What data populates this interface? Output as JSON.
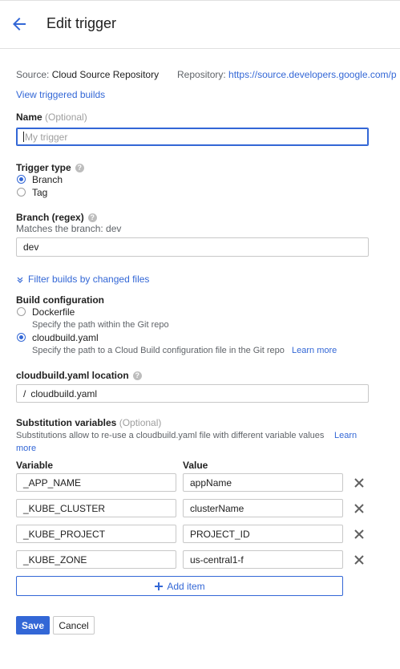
{
  "header": {
    "title": "Edit trigger"
  },
  "source": {
    "label": "Source:",
    "value": "Cloud Source Repository",
    "repo_label": "Repository:",
    "repo_value": "https://source.developers.google.com/p",
    "view_builds": "View triggered builds"
  },
  "name_field": {
    "label": "Name",
    "optional": "(Optional)",
    "placeholder": "My trigger",
    "value": ""
  },
  "trigger_type": {
    "label": "Trigger type",
    "options": [
      {
        "label": "Branch",
        "selected": true
      },
      {
        "label": "Tag",
        "selected": false
      }
    ]
  },
  "branch": {
    "label": "Branch (regex)",
    "hint": "Matches the branch: dev",
    "value": "dev"
  },
  "filter": {
    "label": "Filter builds by changed files"
  },
  "build_config": {
    "label": "Build configuration",
    "options": [
      {
        "label": "Dockerfile",
        "desc": "Specify the path within the Git repo",
        "selected": false
      },
      {
        "label": "cloudbuild.yaml",
        "desc": "Specify the path to a Cloud Build configuration file in the Git repo",
        "selected": true
      }
    ],
    "learn_more": "Learn more"
  },
  "location": {
    "label": "cloudbuild.yaml location",
    "prefix": "/",
    "value": "cloudbuild.yaml"
  },
  "substitutions": {
    "label": "Substitution variables",
    "optional": "(Optional)",
    "desc": "Substitutions allow to re-use a cloudbuild.yaml file with different variable values",
    "learn": "Learn",
    "more": "more",
    "col_variable": "Variable",
    "col_value": "Value",
    "rows": [
      {
        "variable": "_APP_NAME",
        "value": "appName"
      },
      {
        "variable": "_KUBE_CLUSTER",
        "value": "clusterName"
      },
      {
        "variable": "_KUBE_PROJECT",
        "value": "PROJECT_ID"
      },
      {
        "variable": "_KUBE_ZONE",
        "value": "us-central1-f"
      }
    ],
    "add_item": "Add item"
  },
  "actions": {
    "save": "Save",
    "cancel": "Cancel"
  },
  "colors": {
    "accent": "#3367d6"
  }
}
